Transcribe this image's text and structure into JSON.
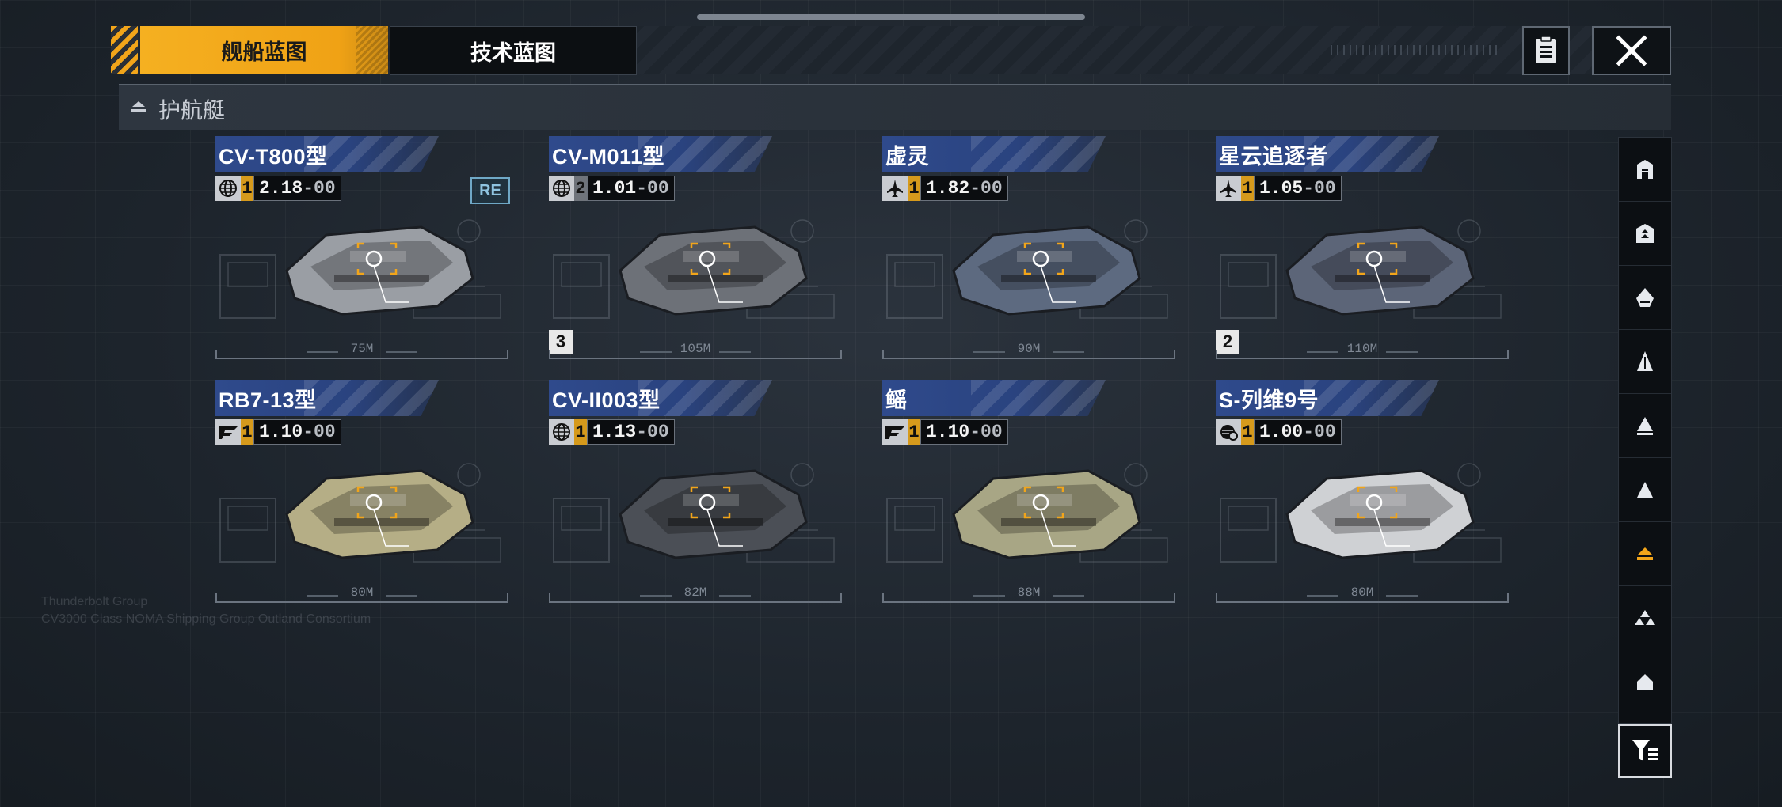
{
  "tabs": [
    {
      "label": "舰船蓝图",
      "active": true
    },
    {
      "label": "技术蓝图",
      "active": false
    }
  ],
  "category": {
    "label": "护航艇",
    "icon": "escort-class-icon"
  },
  "watermark": [
    "Thunderbolt Group",
    "CV3000 Class NOMA Shipping Group Outland Consortium"
  ],
  "ships": [
    {
      "name": "CV-T800型",
      "manufacturer_icon": "globe-icon",
      "tier": "1",
      "value_main": "2.18",
      "value_dec": "-00",
      "badge": "RE",
      "level": "",
      "length": "75M",
      "color": "#9a9ea4"
    },
    {
      "name": "CV-M011型",
      "manufacturer_icon": "globe-icon",
      "tier": "2",
      "value_main": "1.01",
      "value_dec": "-00",
      "badge": "",
      "level": "3",
      "length": "105M",
      "color": "#6d7178"
    },
    {
      "name": "虚灵",
      "manufacturer_icon": "jet-icon",
      "tier": "1",
      "value_main": "1.82",
      "value_dec": "-00",
      "badge": "",
      "level": "",
      "length": "90M",
      "color": "#5d6a80"
    },
    {
      "name": "星云追逐者",
      "manufacturer_icon": "jet-icon",
      "tier": "1",
      "value_main": "1.05",
      "value_dec": "-00",
      "badge": "",
      "level": "2",
      "length": "110M",
      "color": "#5c6578"
    },
    {
      "name": "RB7-13型",
      "manufacturer_icon": "wing-logo-icon",
      "tier": "1",
      "value_main": "1.10",
      "value_dec": "-00",
      "badge": "",
      "level": "",
      "length": "80M",
      "color": "#b5ae86"
    },
    {
      "name": "CV-II003型",
      "manufacturer_icon": "globe-icon",
      "tier": "1",
      "value_main": "1.13",
      "value_dec": "-00",
      "badge": "",
      "level": "",
      "length": "82M",
      "color": "#4b4f56"
    },
    {
      "name": "鳐",
      "manufacturer_icon": "wing-logo-icon",
      "tier": "1",
      "value_main": "1.10",
      "value_dec": "-00",
      "badge": "",
      "level": "",
      "length": "88M",
      "color": "#a8a685"
    },
    {
      "name": "S-列维9号",
      "manufacturer_icon": "gear-globe-icon",
      "tier": "1",
      "value_main": "1.00",
      "value_dec": "-00",
      "badge": "",
      "level": "",
      "length": "80M",
      "color": "#cfd1d4"
    }
  ],
  "sidebar": [
    {
      "icon": "hangar-icon",
      "active": false
    },
    {
      "icon": "carrier-icon",
      "active": false
    },
    {
      "icon": "battleship-icon",
      "active": false
    },
    {
      "icon": "cruiser-icon",
      "active": false
    },
    {
      "icon": "destroyer-icon",
      "active": false
    },
    {
      "icon": "frigate-icon",
      "active": false
    },
    {
      "icon": "escort-icon",
      "active": true
    },
    {
      "icon": "fighter-group-icon",
      "active": false
    },
    {
      "icon": "shuttle-icon",
      "active": false
    }
  ],
  "colors": {
    "accent": "#f2a51a",
    "name_band": "#2f4a8c",
    "background": "#1d242c"
  }
}
